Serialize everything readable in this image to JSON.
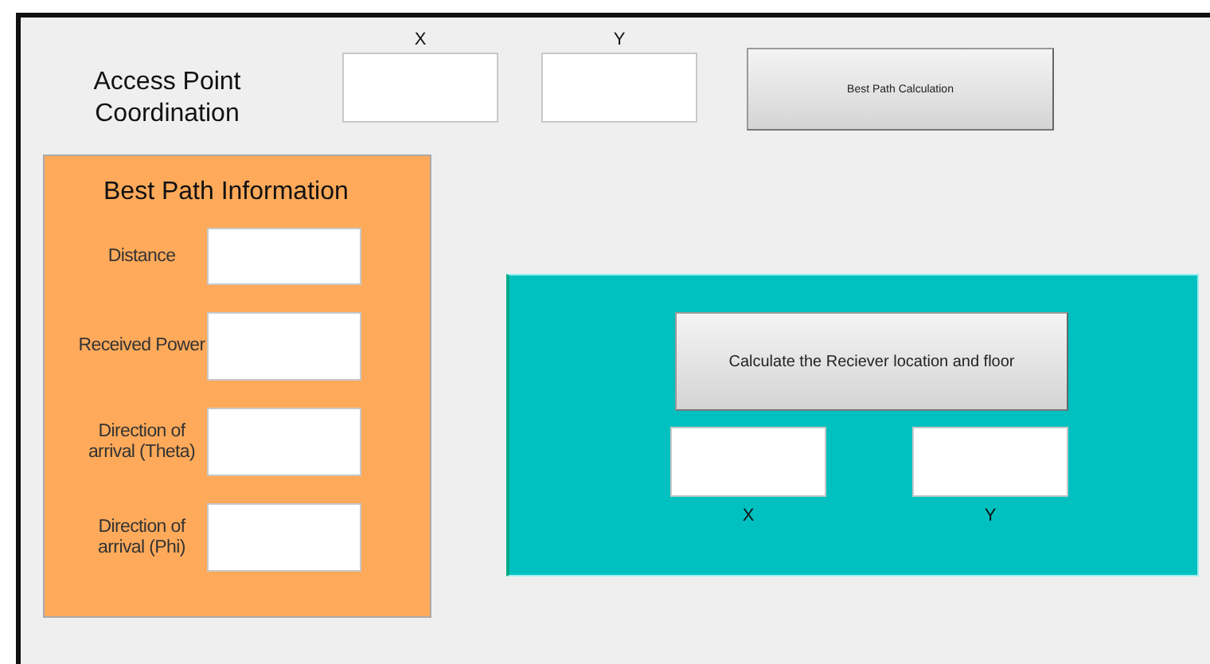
{
  "access_point": {
    "label": "Access Point Coordination",
    "fields": [
      {
        "label": "X"
      },
      {
        "label": "Y"
      }
    ]
  },
  "best_path_button": {
    "label": "Best Path Calculation"
  },
  "best_path_panel": {
    "title": "Best Path Information",
    "fields": [
      {
        "label": "Distance"
      },
      {
        "label": "Received Power"
      },
      {
        "label": "Direction of arrival (Theta)"
      },
      {
        "label": "Direction of arrival (Phi)"
      }
    ]
  },
  "receiver_panel": {
    "button": {
      "label": "Calculate the Reciever location and floor"
    },
    "fields": [
      {
        "label": "X"
      },
      {
        "label": "Y"
      }
    ]
  }
}
